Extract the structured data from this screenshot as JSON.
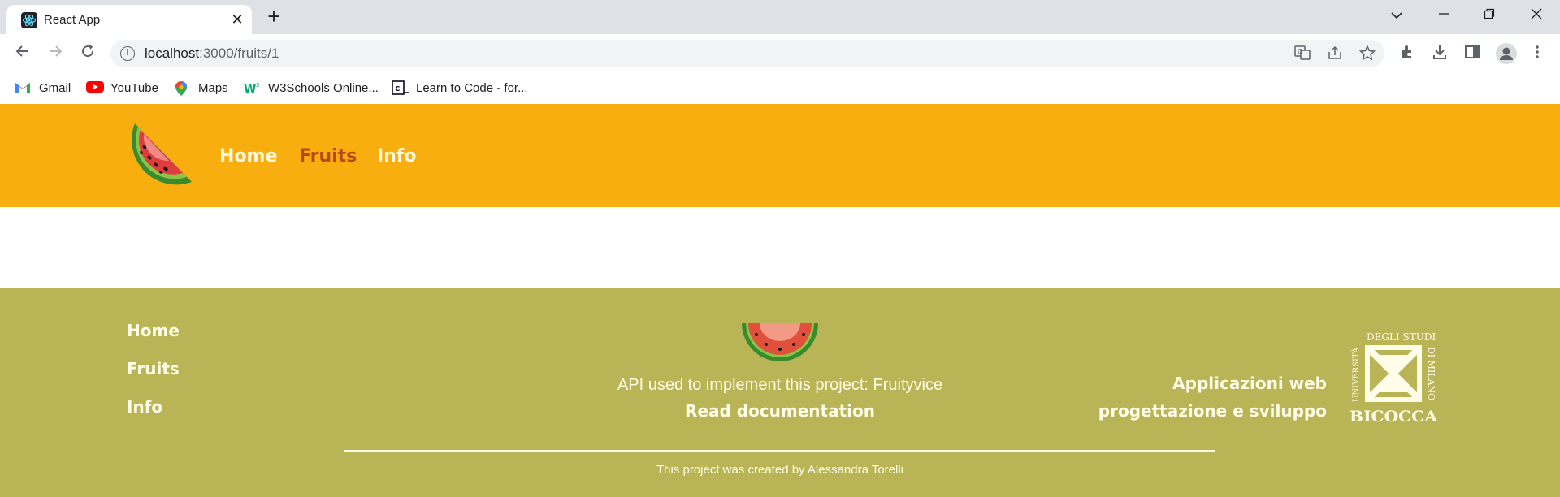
{
  "browser": {
    "tab_title": "React App",
    "tab_close": "✕",
    "new_tab": "+",
    "url_host": "localhost",
    "url_path": ":3000/fruits/1",
    "bookmarks": [
      {
        "label": "Gmail",
        "icon": "gmail-icon"
      },
      {
        "label": "YouTube",
        "icon": "youtube-icon"
      },
      {
        "label": "Maps",
        "icon": "maps-icon"
      },
      {
        "label": "W3Schools Online...",
        "icon": "w3schools-icon"
      },
      {
        "label": "Learn to Code - for...",
        "icon": "freecodecamp-icon"
      }
    ]
  },
  "header": {
    "nav": [
      "Home",
      "Fruits",
      "Info"
    ],
    "active": "Fruits"
  },
  "footer": {
    "links": [
      "Home",
      "Fruits",
      "Info"
    ],
    "api_text": "API used to implement this project: Fruityvice",
    "api_link": "Read documentation",
    "course_line1": "Applicazioni web",
    "course_line2": "progettazione e sviluppo",
    "university_logo": {
      "top": "DEGLI STUDI",
      "right": "DI MILANO",
      "left": "UNIVERSITÀ",
      "bottom": "BICOCCA"
    },
    "credit": "This project was created by Alessandra Torelli"
  },
  "colors": {
    "header_bg": "#f7ae0e",
    "footer_bg": "#b9b556",
    "nav_active": "#b8471e",
    "light_text": "#fffce8"
  }
}
